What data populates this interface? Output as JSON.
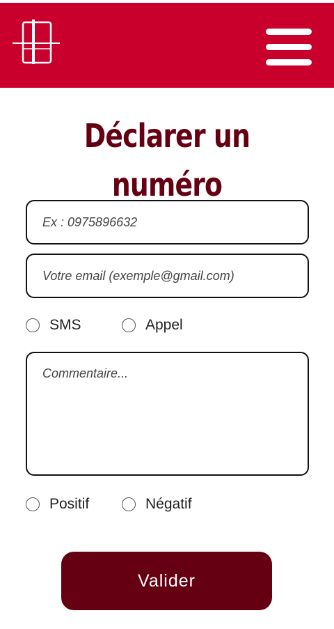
{
  "header": {
    "background_color": "#c8002b",
    "logo_icon": "logo-icon",
    "menu_icon": "hamburger-menu-icon"
  },
  "page": {
    "title": "Déclarer un numéro",
    "title_color": "#650012"
  },
  "form": {
    "phone": {
      "placeholder": "Ex : 0975896632",
      "value": ""
    },
    "email": {
      "placeholder": "Votre email (exemple@gmail.com)",
      "value": ""
    },
    "contact_type": {
      "options": [
        "SMS",
        "Appel"
      ],
      "selected": null
    },
    "comment": {
      "placeholder": "Commentaire...",
      "value": ""
    },
    "rating": {
      "options": [
        "Positif",
        "Négatif"
      ],
      "selected": null
    },
    "submit_label": "Valider",
    "submit_color": "#650012"
  }
}
